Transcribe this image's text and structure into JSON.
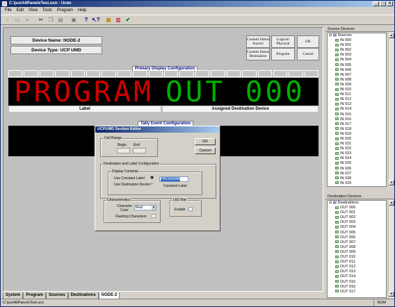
{
  "window": {
    "title": "C:\\jus\\AllPanelsTest.ucn - Ucen",
    "buttons": [
      "_",
      "□",
      "×"
    ]
  },
  "menu": [
    "File",
    "Edit",
    "View",
    "Tools",
    "Program",
    "Help"
  ],
  "device": {
    "name_label": "Device Name: NODE-2",
    "type_label": "Device Type: UCP UMD"
  },
  "buttons": {
    "custom_source": "Custom Status Source",
    "logical_physical": "Logical/ Physical",
    "ok": "OK",
    "custom_destination": "Custom Status Destination",
    "program": "Program",
    "cancel": "Cancel"
  },
  "primary": {
    "title": "Primary Display Configuration",
    "left_text": "PROGRAM",
    "right_text": "OUT 000",
    "left_label": "Label",
    "right_label": "Assigned Destination Device"
  },
  "tally": {
    "title": "Tally Event Configuration"
  },
  "dialog": {
    "title": "UCPUMD Section Editor",
    "cell_range": "Cell Range",
    "begin": "Begin",
    "end": "End",
    "ok": "OK",
    "cancel": "Cancel",
    "dest_label_config": "Destination and Label Configuration",
    "display_contents": "Display Contents",
    "use_constant_label": "Use Constant Label",
    "use_destination_device": "Use Destination Device",
    "constant_value": "PROGRAM",
    "constant_label": "Constant Label",
    "characteristics": "Characteristics",
    "character_color": "Character Color",
    "color_value": "Red",
    "flashing": "Flashing Characters",
    "led_bar": "LED Bar",
    "enable": "Enable"
  },
  "tabs": [
    "System",
    "Program",
    "Sources",
    "Destinations",
    "NODE-2"
  ],
  "active_tab": "NODE-2",
  "status": {
    "path": "C:\\jus\\AllPanelsTest.ucn",
    "num": "NUM"
  },
  "source_devices": {
    "title": "Source Devices",
    "root": "Sources",
    "items": [
      "IN 000",
      "IN 001",
      "IN 002",
      "IN 003",
      "IN 004",
      "IN 005",
      "IN 006",
      "IN 007",
      "IN 008",
      "IN 009",
      "IN 010",
      "IN 011",
      "IN 012",
      "IN 013",
      "IN 014",
      "IN 015",
      "IN 016",
      "IN 017",
      "IN 018",
      "IN 019",
      "IN 020",
      "IN 021",
      "IN 022",
      "IN 023",
      "IN 024",
      "IN 025",
      "IN 026",
      "IN 027",
      "IN 028",
      "IN 029"
    ]
  },
  "destination_devices": {
    "title": "Destination Devices",
    "root": "Destinations",
    "items": [
      "OUT 000",
      "OUT 001",
      "OUT 002",
      "OUT 003",
      "OUT 004",
      "OUT 005",
      "OUT 006",
      "OUT 007",
      "OUT 008",
      "OUT 009",
      "OUT 010",
      "OUT 011",
      "OUT 012",
      "OUT 013",
      "OUT 014",
      "OUT 015",
      "OUT 016",
      "OUT 017"
    ]
  },
  "colors": {
    "red_text": "#d00000",
    "green_text": "#00b000",
    "title_start": "#0a246a",
    "title_end": "#a6caf0"
  }
}
